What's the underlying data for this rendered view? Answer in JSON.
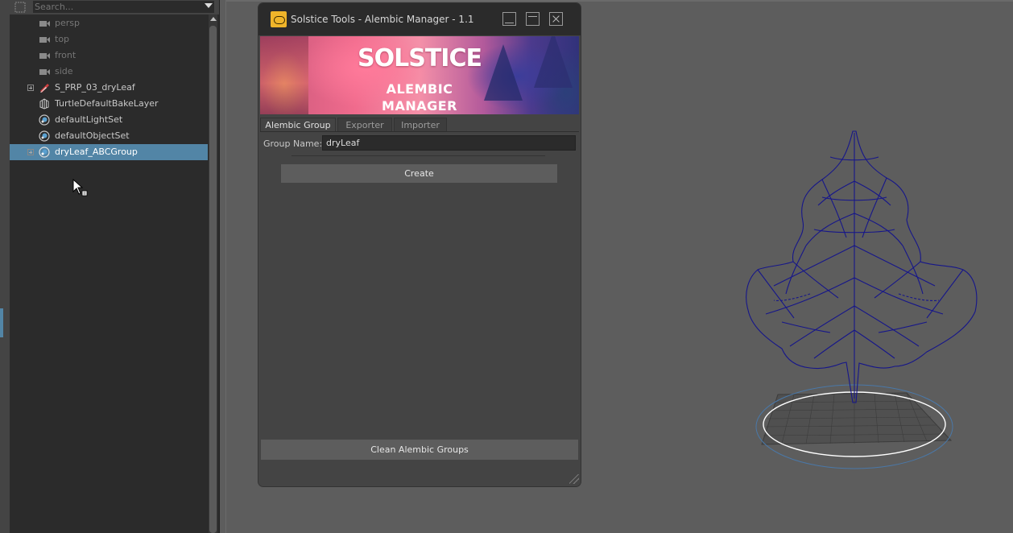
{
  "outliner": {
    "search_placeholder": "Search...",
    "items": [
      {
        "label": "persp",
        "type": "camera"
      },
      {
        "label": "top",
        "type": "camera"
      },
      {
        "label": "front",
        "type": "camera"
      },
      {
        "label": "side",
        "type": "camera"
      },
      {
        "label": "S_PRP_03_dryLeaf",
        "type": "transform"
      },
      {
        "label": "TurtleDefaultBakeLayer",
        "type": "bake-layer"
      },
      {
        "label": "defaultLightSet",
        "type": "set"
      },
      {
        "label": "defaultObjectSet",
        "type": "set"
      },
      {
        "label": "dryLeaf_ABCGroup",
        "type": "set",
        "selected": true
      }
    ]
  },
  "dialog": {
    "title": "Solstice Tools - Alembic Manager - 1.1",
    "banner": {
      "line1": "SOLSTICE",
      "line2": "ALEMBIC",
      "line3": "MANAGER"
    },
    "tabs": [
      "Alembic Group",
      "Exporter",
      "Importer"
    ],
    "active_tab": "Alembic Group",
    "group_name_label": "Group Name:",
    "group_name_value": "dryLeaf",
    "create_label": "Create",
    "clean_label": "Clean Alembic Groups"
  },
  "colors": {
    "selection": "#5285a6",
    "wireframe": "#1a1a8a",
    "panel": "#444444",
    "viewport_bg": "#5d5d5d"
  }
}
